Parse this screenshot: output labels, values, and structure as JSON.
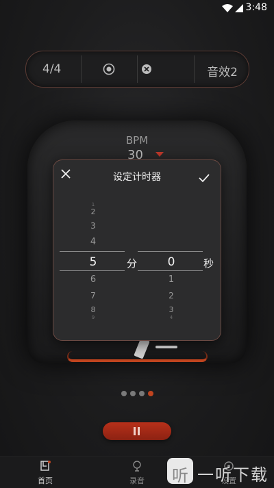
{
  "status_bar": {
    "time": "3:48"
  },
  "controls": {
    "beat": "4/4",
    "sound": "音效2"
  },
  "metronome": {
    "bpm_label": "BPM",
    "bpm_value": "30"
  },
  "timer_dialog": {
    "title": "设定计时器",
    "minutes": {
      "above": [
        "1",
        "2",
        "3",
        "4"
      ],
      "selected": "5",
      "below": [
        "6",
        "7",
        "8",
        "9"
      ],
      "unit": "分"
    },
    "seconds": {
      "above": [],
      "selected": "0",
      "below": [
        "1",
        "2",
        "3",
        "4"
      ],
      "unit": "秒"
    }
  },
  "page_indicator": {
    "count": 4,
    "active_index": 3
  },
  "bottom_nav": [
    {
      "label": "首页",
      "active": true
    },
    {
      "label": "录音",
      "active": false
    },
    {
      "label": "设置",
      "active": false
    }
  ],
  "watermark": {
    "glyph": "听",
    "text": "一听下载"
  },
  "colors": {
    "accent": "#c0441f",
    "background": "#1c1c1d",
    "dialog": "#2c2c2d"
  },
  "icons": [
    "wifi-icon",
    "signal-icon",
    "battery-icon",
    "record-icon",
    "clear-icon",
    "close-icon",
    "confirm-icon",
    "pause-icon",
    "home-icon",
    "mic-icon",
    "settings-icon"
  ]
}
